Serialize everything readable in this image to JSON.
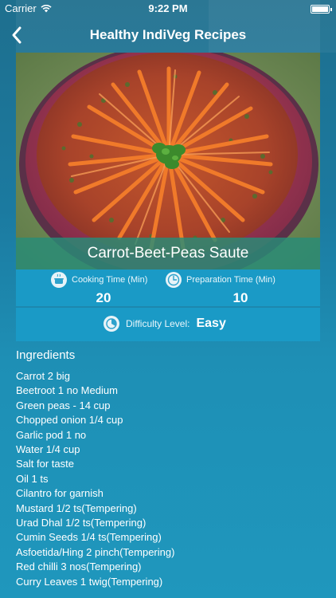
{
  "status_bar": {
    "carrier": "Carrier",
    "time": "9:22 PM"
  },
  "nav": {
    "title": "Healthy IndiVeg Recipes",
    "back_icon": "chevron-left-icon"
  },
  "recipe": {
    "name": "Carrot-Beet-Peas Saute",
    "cooking_time_label": "Cooking Time (Min)",
    "cooking_time_value": "20",
    "prep_time_label": "Preparation Time (Min)",
    "prep_time_value": "10",
    "difficulty_label": "Difficulty Level:",
    "difficulty_value": "Easy"
  },
  "ingredients": {
    "heading": "Ingredients",
    "items": [
      "Carrot 2 big",
      "Beetroot 1 no Medium",
      "Green peas - 14 cup",
      "Chopped onion 1/4 cup",
      "Garlic pod 1 no",
      "Water 1/4 cup",
      "Salt for taste",
      "Oil 1 ts",
      "Cilantro for garnish",
      "Mustard 1/2 ts(Tempering)",
      "Urad Dhal 1/2 ts(Tempering)",
      "Cumin Seeds 1/4 ts(Tempering)",
      "Asfoetida/Hing 2 pinch(Tempering)",
      "Red chilli 3 nos(Tempering)",
      "Curry Leaves 1 twig(Tempering)"
    ]
  },
  "colors": {
    "panel": "#1a9ac6",
    "caption": "#288c78"
  }
}
